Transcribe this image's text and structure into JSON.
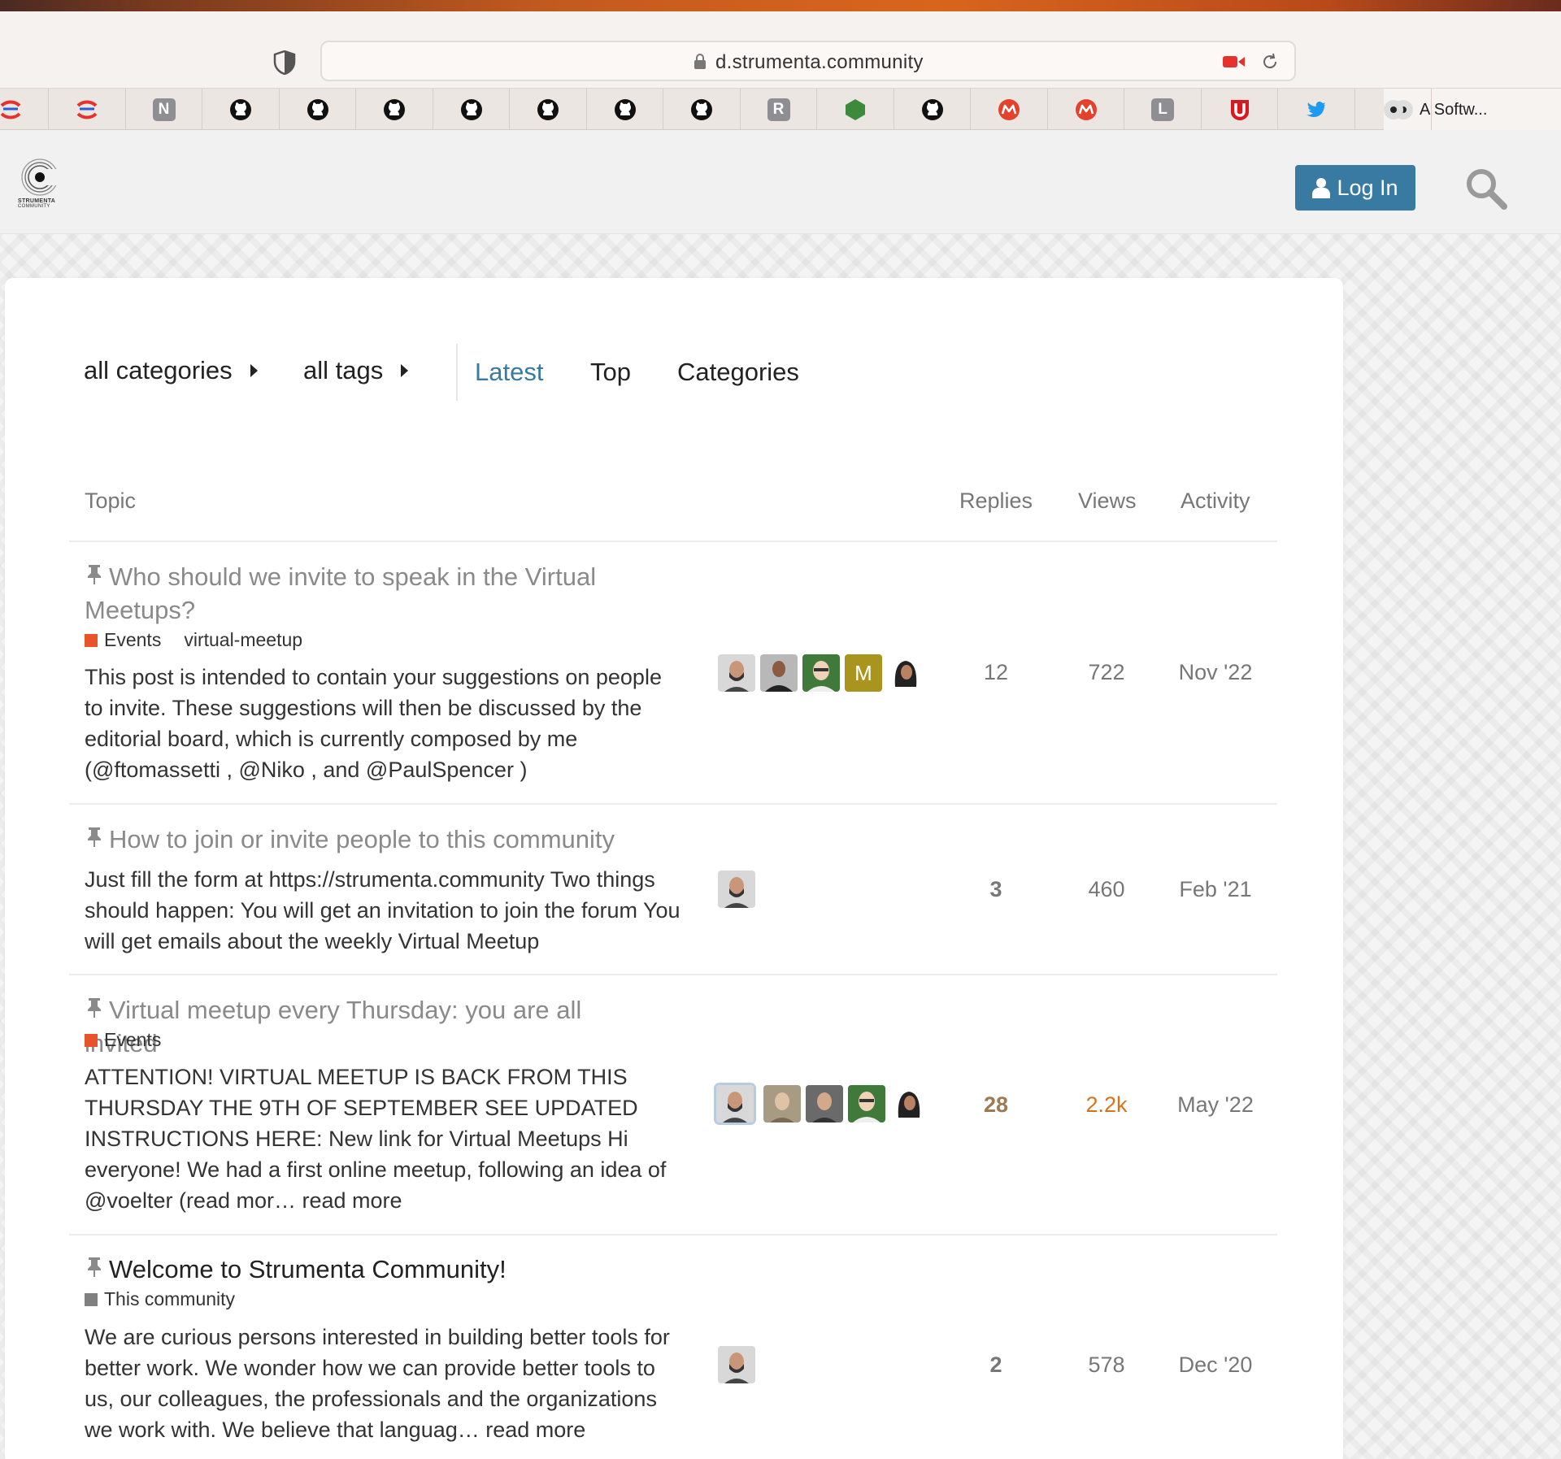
{
  "browser": {
    "url": "d.strumenta.community",
    "tabs": [
      {
        "icon": "mastodon-icon",
        "type": "mark"
      },
      {
        "icon": "scrivito-icon",
        "type": "mark"
      },
      {
        "icon": "n-letter-icon",
        "type": "letter",
        "letter": "N"
      },
      {
        "icon": "github-icon",
        "type": "github"
      },
      {
        "icon": "github-icon",
        "type": "github"
      },
      {
        "icon": "github-icon",
        "type": "github"
      },
      {
        "icon": "github-icon",
        "type": "github"
      },
      {
        "icon": "github-icon",
        "type": "github"
      },
      {
        "icon": "github-icon",
        "type": "github"
      },
      {
        "icon": "github-icon",
        "type": "github"
      },
      {
        "icon": "r-letter-icon",
        "type": "letter",
        "letter": "R"
      },
      {
        "icon": "hexagon-icon",
        "type": "hexagon"
      },
      {
        "icon": "github-icon",
        "type": "github"
      },
      {
        "icon": "meetup-icon",
        "type": "meetup"
      },
      {
        "icon": "meetup-icon",
        "type": "meetup"
      },
      {
        "icon": "l-letter-icon",
        "type": "letter",
        "letter": "L"
      },
      {
        "icon": "u-shield-icon",
        "type": "ushield"
      },
      {
        "icon": "twitter-icon",
        "type": "twitter"
      },
      {
        "icon": "strumenta-icon",
        "type": "strumenta"
      }
    ],
    "last_tab_label": "A Softw..."
  },
  "header": {
    "logo_text": "STRUMENTA",
    "logo_subtext": "COMMUNITY",
    "login_label": "Log In"
  },
  "nav": {
    "categories_label": "all categories",
    "tags_label": "all tags",
    "latest_label": "Latest",
    "top_label": "Top",
    "categories_tab_label": "Categories"
  },
  "table_headers": {
    "topic": "Topic",
    "replies": "Replies",
    "views": "Views",
    "activity": "Activity"
  },
  "colors": {
    "accent": "#387aa2",
    "events": "#e9532c",
    "this_community": "#808080"
  },
  "topics": [
    {
      "title": "Who should we invite to speak in the Virtual Meetups?",
      "category": "Events",
      "tag": "virtual-meetup",
      "excerpt": "This post is intended to contain your suggestions on people to invite. These suggestions will then be discussed by the editorial board, which is currently composed by me (@ftomassetti , @Niko , and @PaulSpencer )",
      "replies": "12",
      "views": "722",
      "activity": "Nov '22"
    },
    {
      "title": "How to join or invite people to this community",
      "excerpt": "Just fill the form at https://strumenta.community Two things should happen: You will get an invitation to join the forum You will get emails about the weekly Virtual Meetup",
      "replies": "3",
      "views": "460",
      "activity": "Feb '21"
    },
    {
      "title": "Virtual meetup every Thursday: you are all invited",
      "category": "Events",
      "excerpt": "ATTENTION! VIRTUAL MEETUP IS BACK FROM THIS THURSDAY THE 9TH OF SEPTEMBER SEE UPDATED INSTRUCTIONS HERE: New link for Virtual Meetups Hi everyone! We had a first online meetup, following an idea of @voelter (read mor… read more",
      "replies": "28",
      "views": "2.2k",
      "activity": "May '22"
    },
    {
      "title": "Welcome to Strumenta Community!",
      "category": "This community",
      "excerpt": "We are curious persons interested in building better tools for better work. We wonder how we can provide better tools to us, our colleagues, the professionals and the organizations we work with. We believe that languag… read more",
      "replies": "2",
      "views": "578",
      "activity": "Dec '20"
    }
  ],
  "avatar_letter": "M"
}
